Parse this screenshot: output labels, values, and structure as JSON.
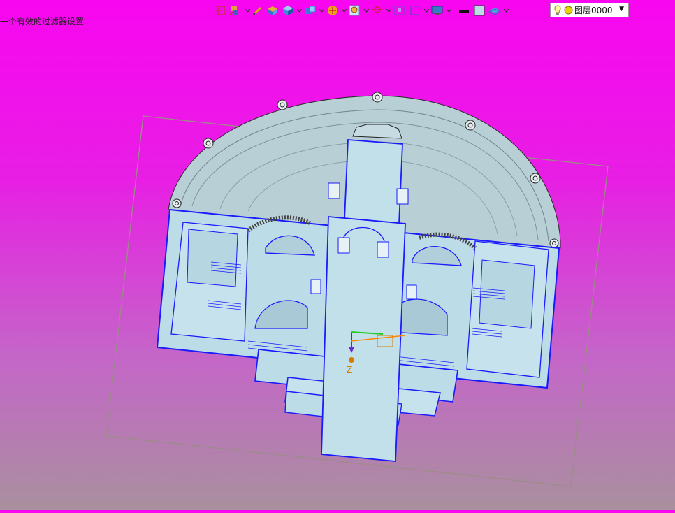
{
  "status": {
    "message": "一个有效的过滤器设置."
  },
  "toolbar": {
    "icons": [
      "exit-icon",
      "select-filter-icon",
      "snap-pencil-icon",
      "open-part-icon",
      "solid-cube-icon",
      "view-box-icon",
      "render-style-icon",
      "zoom-view-icon",
      "snap-point-icon",
      "fit-frame-icon",
      "section-view-icon",
      "monitor-display-icon",
      "line-color-icon",
      "fill-color-icon",
      "layer-stack-icon"
    ],
    "layer": {
      "label": "图层0000"
    }
  },
  "viewport": {
    "background_top": "#f806f0",
    "background_bottom": "#a9909e",
    "model_color": "#bcdce8",
    "edge_color": "#1a1aff",
    "cover_color": "#b9cfd6",
    "triad": {
      "z_label": "Z"
    }
  }
}
